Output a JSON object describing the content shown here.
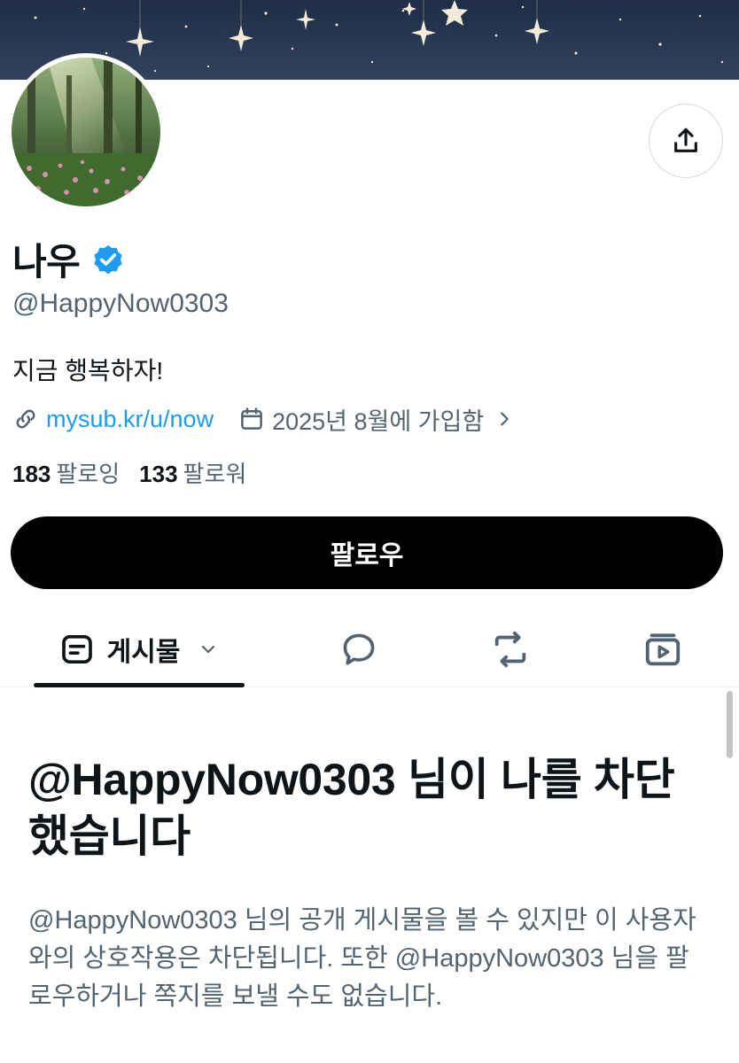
{
  "profile": {
    "display_name": "나우",
    "handle": "@HappyNow0303",
    "bio": "지금 행복하자!",
    "link_text": "mysub.kr/u/now",
    "joined_text": "2025년 8월에 가입함",
    "following_count": "183",
    "following_label": "팔로잉",
    "followers_count": "133",
    "followers_label": "팔로워",
    "verified_color": "#1d9bf0"
  },
  "actions": {
    "follow_label": "팔로우",
    "share_icon": "share-icon"
  },
  "tabs": {
    "posts_label": "게시물",
    "items": [
      {
        "icon": "posts-icon"
      },
      {
        "icon": "reply-bubble-icon"
      },
      {
        "icon": "repost-icon"
      },
      {
        "icon": "video-icon"
      }
    ]
  },
  "blocked": {
    "title": "@HappyNow0303 님이 나를 차단했습니다",
    "description": "@HappyNow0303 님의 공개 게시물을 볼 수 있지만 이 사용자와의 상호작용은 차단됩니다. 또한 @HappyNow0303 님을 팔로우하거나 쪽지를 보낼 수도 없습니다."
  }
}
